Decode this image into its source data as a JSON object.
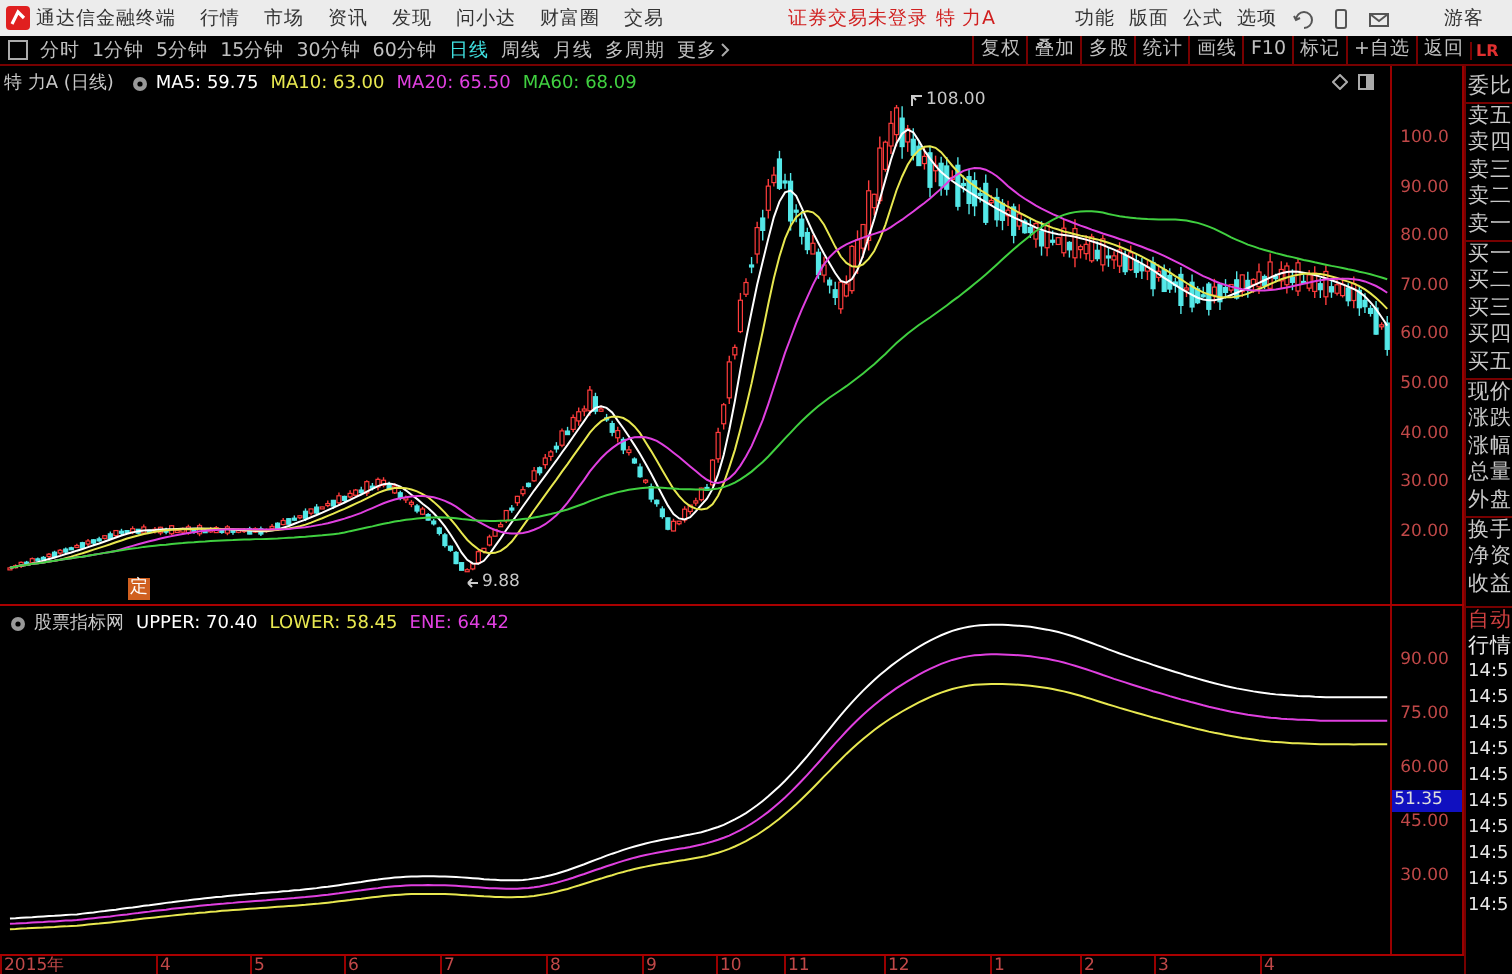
{
  "menubar": {
    "app_title": "通达信金融终端",
    "menus": [
      "行情",
      "市场",
      "资讯",
      "发现",
      "问小达",
      "财富圈",
      "交易"
    ],
    "notice": "证券交易未登录",
    "stock": "特 力A",
    "tools": [
      "功能",
      "版面",
      "公式",
      "选项"
    ],
    "user": "游客"
  },
  "period_tabs": [
    {
      "label": "分时",
      "selected": false
    },
    {
      "label": "1分钟",
      "selected": false
    },
    {
      "label": "5分钟",
      "selected": false
    },
    {
      "label": "15分钟",
      "selected": false
    },
    {
      "label": "30分钟",
      "selected": false
    },
    {
      "label": "60分钟",
      "selected": false
    },
    {
      "label": "日线",
      "selected": true
    },
    {
      "label": "周线",
      "selected": false
    },
    {
      "label": "月线",
      "selected": false
    },
    {
      "label": "多周期",
      "selected": false
    },
    {
      "label": "更多",
      "selected": false
    }
  ],
  "chart_tools": [
    "复权",
    "叠加",
    "多股",
    "统计",
    "画线",
    "F10",
    "标记",
    "+自选",
    "返回"
  ],
  "panel_header": [
    "L",
    "R"
  ],
  "price_chart": {
    "title": "特 力A (日线)",
    "legend": [
      {
        "label": "MA5: 59.75",
        "color": "#ffffff"
      },
      {
        "label": "MA10: 63.00",
        "color": "#e8e850"
      },
      {
        "label": "MA20: 65.50",
        "color": "#e040e0"
      },
      {
        "label": "MA60: 68.09",
        "color": "#40d040"
      }
    ],
    "high_label": "108.00",
    "low_label": "9.88",
    "marker": "定",
    "yticks": [
      "100.0",
      "90.00",
      "80.00",
      "70.00",
      "60.00",
      "50.00",
      "40.00",
      "30.00",
      "20.00"
    ]
  },
  "quote_fields": [
    "委比",
    "卖五",
    "卖四",
    "卖三",
    "卖二",
    "卖一",
    "买一",
    "买二",
    "买三",
    "买四",
    "买五",
    "现价",
    "涨跌",
    "涨幅",
    "总量",
    "外盘",
    "换手",
    "净资",
    "收益"
  ],
  "indicator": {
    "name": "股票指标网",
    "legend": [
      {
        "label": "UPPER: 70.40",
        "color": "#ffffff"
      },
      {
        "label": "LOWER: 58.45",
        "color": "#e8e850"
      },
      {
        "label": "ENE: 64.42",
        "color": "#e040e0"
      }
    ],
    "yticks": [
      "90.00",
      "75.00",
      "60.00",
      "45.00",
      "30.00"
    ],
    "current_value": "51.35"
  },
  "tick_panel": {
    "mode": "自动",
    "title": "行情",
    "times": [
      "14:5",
      "14:5",
      "14:5",
      "14:5",
      "14:5",
      "14:5",
      "14:5",
      "14:5",
      "14:5",
      "14:5"
    ]
  },
  "xaxis": [
    "2015年",
    "4",
    "5",
    "6",
    "7",
    "8",
    "9",
    "10",
    "11",
    "12",
    "1",
    "2",
    "3",
    "4"
  ]
}
